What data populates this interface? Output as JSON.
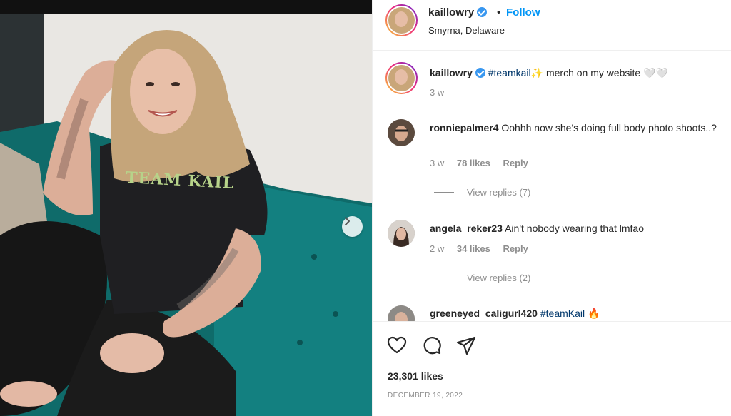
{
  "post": {
    "author": "kaillowry",
    "follow_label": "Follow",
    "separator": "•",
    "location": "Smyrna, Delaware",
    "photo_alt": "Photo of a woman in a black TEAM KAIL t-shirt sitting on a teal velvet couch",
    "shirt_text": "TEAM KAIL"
  },
  "caption": {
    "user": "kaillowry",
    "hashtag": "#teamkail",
    "emoji": "✨",
    "text": " merch on my website ",
    "trailing": "🤍🤍",
    "time": "3 w"
  },
  "comments": [
    {
      "user": "ronniepalmer4",
      "text": "Oohhh now she's doing full body photo shoots..?",
      "time": "3 w",
      "likes": "78 likes",
      "reply": "Reply",
      "view_replies": "View replies (7)"
    },
    {
      "user": "angela_reker23",
      "text": "Ain't nobody wearing that lmfao",
      "time": "2 w",
      "likes": "34 likes",
      "reply": "Reply",
      "view_replies": "View replies (2)"
    },
    {
      "user": "greeneyed_caligurl420",
      "hashtag": "#teamKail",
      "emoji": "🔥"
    }
  ],
  "footer": {
    "likes": "23,301 likes",
    "date": "DECEMBER 19, 2022"
  },
  "icons": {
    "like": "heart-icon",
    "comment": "comment-icon",
    "share": "share-icon",
    "next": "chevron-right-icon",
    "verified": "verified-badge-icon"
  },
  "colors": {
    "link_blue": "#0095f6",
    "hashtag": "#00376b",
    "verified": "#3897f0",
    "muted": "#8e8e8e",
    "couch": "#0f6b6a"
  }
}
